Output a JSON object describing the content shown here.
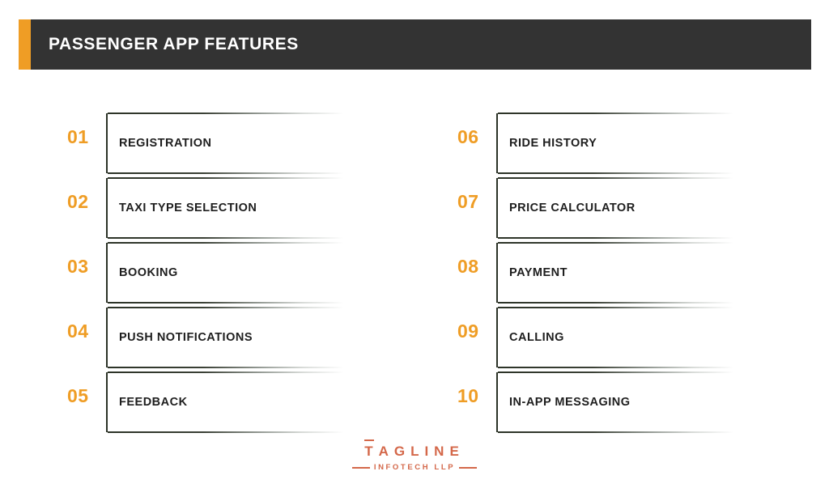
{
  "header": {
    "title": "PASSENGER APP FEATURES",
    "accent_color": "#EF9D25",
    "background_color": "#333333",
    "text_color": "#FFFFFF"
  },
  "page": {
    "background_color": "#FFFFFF"
  },
  "features": {
    "left_column": [
      {
        "number": "01",
        "label": "REGISTRATION"
      },
      {
        "number": "02",
        "label": "TAXI TYPE SELECTION"
      },
      {
        "number": "03",
        "label": "BOOKING"
      },
      {
        "number": "04",
        "label": "PUSH NOTIFICATIONS"
      },
      {
        "number": "05",
        "label": "FEEDBACK"
      }
    ],
    "right_column": [
      {
        "number": "06",
        "label": "RIDE HISTORY"
      },
      {
        "number": "07",
        "label": "PRICE CALCULATOR"
      },
      {
        "number": "08",
        "label": "PAYMENT"
      },
      {
        "number": "09",
        "label": "CALLING"
      },
      {
        "number": "10",
        "label": "IN-APP MESSAGING"
      }
    ],
    "number_color": "#EF9D25",
    "label_color": "#1E1E1E",
    "box_border_color": "#2C3327"
  },
  "footer": {
    "wordmark_t": "T",
    "wordmark_rest": "AGLINE",
    "subtext": "INFOTECH LLP",
    "color": "#D4684A"
  }
}
